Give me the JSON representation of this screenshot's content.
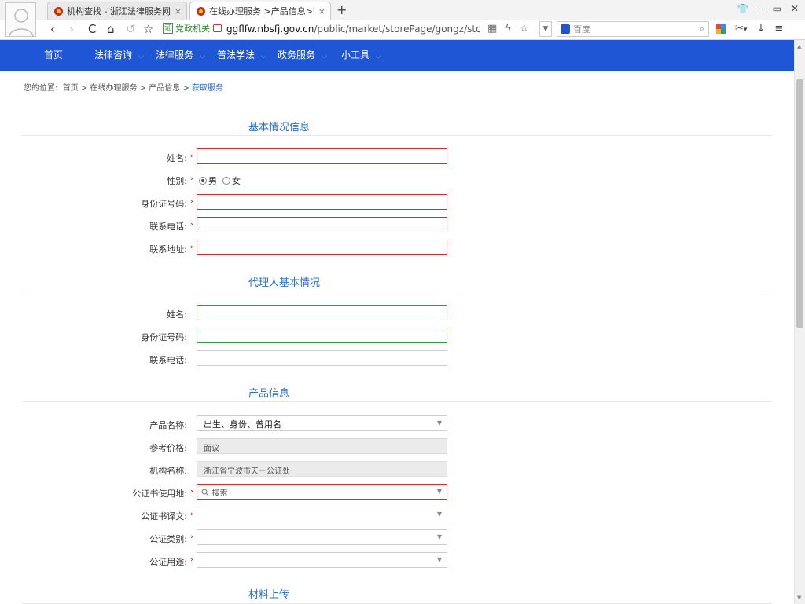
{
  "browser": {
    "tabs": [
      {
        "title": "机构查找 - 浙江法律服务网●宁波",
        "close": "×"
      },
      {
        "title": "在线办理服务 >产品信息>获取服务",
        "close": "×"
      }
    ],
    "new_tab": "+",
    "window_controls": {
      "skin": "👕",
      "minimize": "–",
      "maximize": "▭",
      "close": "✕"
    },
    "nav": {
      "back": "‹",
      "forward": "›",
      "reload": "C",
      "home": "⌂",
      "undo": "↺",
      "bookmark": "☆"
    },
    "gov_badge_icon": "证",
    "gov_badge": "党政机关",
    "url_host": "ggflfw.nbsfj.gov.cn",
    "url_path": "/public/market/storePage/gongz/store_g",
    "url_icons": {
      "qr": "▦",
      "lightning": "ϟ",
      "star": "☆"
    },
    "search_dropdown": "▼",
    "search_placeholder": "百度",
    "search_icon": "⌕",
    "tools": {
      "cut": "✂",
      "cut_dd": "▾",
      "download": "↓",
      "menu": "≡"
    }
  },
  "site_nav": [
    {
      "label": "首页",
      "chevron": ""
    },
    {
      "label": "法律咨询",
      "chevron": "⌵"
    },
    {
      "label": "法律服务",
      "chevron": "⌵"
    },
    {
      "label": "普法学法",
      "chevron": "⌵"
    },
    {
      "label": "政务服务",
      "chevron": "⌵"
    },
    {
      "label": "小工具",
      "chevron": "⌵"
    }
  ],
  "breadcrumb": {
    "prefix": "您的位置:",
    "items": [
      "首页",
      "在线办理服务",
      "产品信息"
    ],
    "separator": ">",
    "current": "获取服务"
  },
  "required_mark": "›",
  "basic": {
    "title": "基本情况信息",
    "name_label": "姓名:",
    "gender_label": "性别:",
    "gender_male": "男",
    "gender_female": "女",
    "gender_selected": "男",
    "id_label": "身份证号码:",
    "phone_label": "联系电话:",
    "address_label": "联系地址:"
  },
  "agent": {
    "title": "代理人基本情况",
    "name_label": "姓名:",
    "id_label": "身份证号码:",
    "phone_label": "联系电话:"
  },
  "product": {
    "title": "产品信息",
    "name_label": "产品名称:",
    "name_value": "出生、身份、曾用名",
    "price_label": "参考价格:",
    "price_value": "面议",
    "org_label": "机构名称:",
    "org_value": "浙江省宁波市天一公证处",
    "place_label": "公证书使用地:",
    "place_placeholder": "搜索",
    "translation_label": "公证书译文:",
    "category_label": "公证类别:",
    "purpose_label": "公证用途:",
    "select_arrow": "▼"
  },
  "upload": {
    "title": "材料上传"
  },
  "scroll": {
    "up": "▲",
    "down": "▼"
  }
}
